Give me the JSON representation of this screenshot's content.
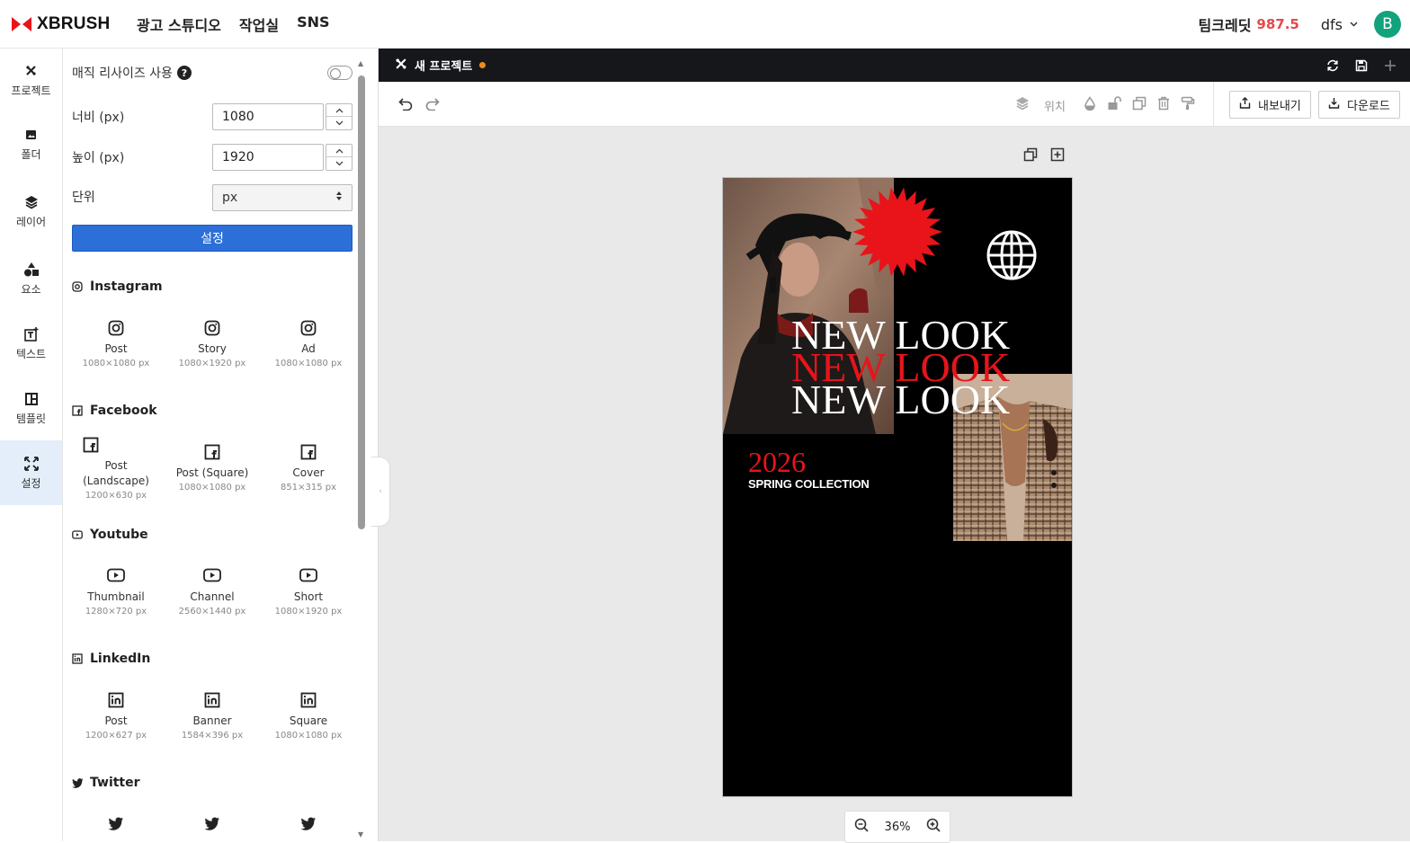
{
  "header": {
    "brand": "XBRUSH",
    "nav": [
      "광고 스튜디오",
      "작업실",
      "SNS"
    ],
    "credit_label": "팀크레딧",
    "credit_value": "987.5",
    "user_name": "dfs",
    "avatar_letter": "B",
    "brand_color": "#e8141a",
    "avatar_color": "#12a37c"
  },
  "rail": {
    "items": [
      {
        "label": "프로젝트",
        "icon": "project-icon"
      },
      {
        "label": "폴더",
        "icon": "folder-icon"
      },
      {
        "label": "레이어",
        "icon": "layers-icon"
      },
      {
        "label": "요소",
        "icon": "shapes-icon"
      },
      {
        "label": "텍스트",
        "icon": "text-icon"
      },
      {
        "label": "템플릿",
        "icon": "template-icon"
      },
      {
        "label": "설정",
        "icon": "resize-icon",
        "active": true
      }
    ]
  },
  "settings": {
    "magic_resize_label": "매직 리사이즈 사용",
    "magic_resize_on": false,
    "width_label": "너비 (px)",
    "width_value": "1080",
    "height_label": "높이 (px)",
    "height_value": "1920",
    "unit_label": "단위",
    "unit_value": "px",
    "apply_label": "설정"
  },
  "presets": {
    "instagram": {
      "title": "Instagram",
      "items": [
        {
          "name": "Post",
          "size": "1080×1080 px"
        },
        {
          "name": "Story",
          "size": "1080×1920 px"
        },
        {
          "name": "Ad",
          "size": "1080×1080 px"
        }
      ]
    },
    "facebook": {
      "title": "Facebook",
      "items": [
        {
          "name": "Post",
          "name2": "(Landscape)",
          "size": "1200×630 px"
        },
        {
          "name": "Post (Square)",
          "size": "1080×1080 px"
        },
        {
          "name": "Cover",
          "size": "851×315 px"
        }
      ]
    },
    "youtube": {
      "title": "Youtube",
      "items": [
        {
          "name": "Thumbnail",
          "size": "1280×720 px"
        },
        {
          "name": "Channel",
          "size": "2560×1440 px"
        },
        {
          "name": "Short",
          "size": "1080×1920 px"
        }
      ]
    },
    "linkedin": {
      "title": "LinkedIn",
      "items": [
        {
          "name": "Post",
          "size": "1200×627 px"
        },
        {
          "name": "Banner",
          "size": "1584×396 px"
        },
        {
          "name": "Square",
          "size": "1080×1080 px"
        }
      ]
    },
    "twitter": {
      "title": "Twitter"
    }
  },
  "editor": {
    "tab_title": "새 프로젝트",
    "unsaved": true,
    "position_label": "위치",
    "export_label": "내보내기",
    "download_label": "다운로드",
    "zoom": "36%"
  },
  "artboard": {
    "headline": "NEW LOOK",
    "year": "2026",
    "subtitle": "SPRING COLLECTION",
    "background": "#000000",
    "accent": "#e8141a"
  }
}
